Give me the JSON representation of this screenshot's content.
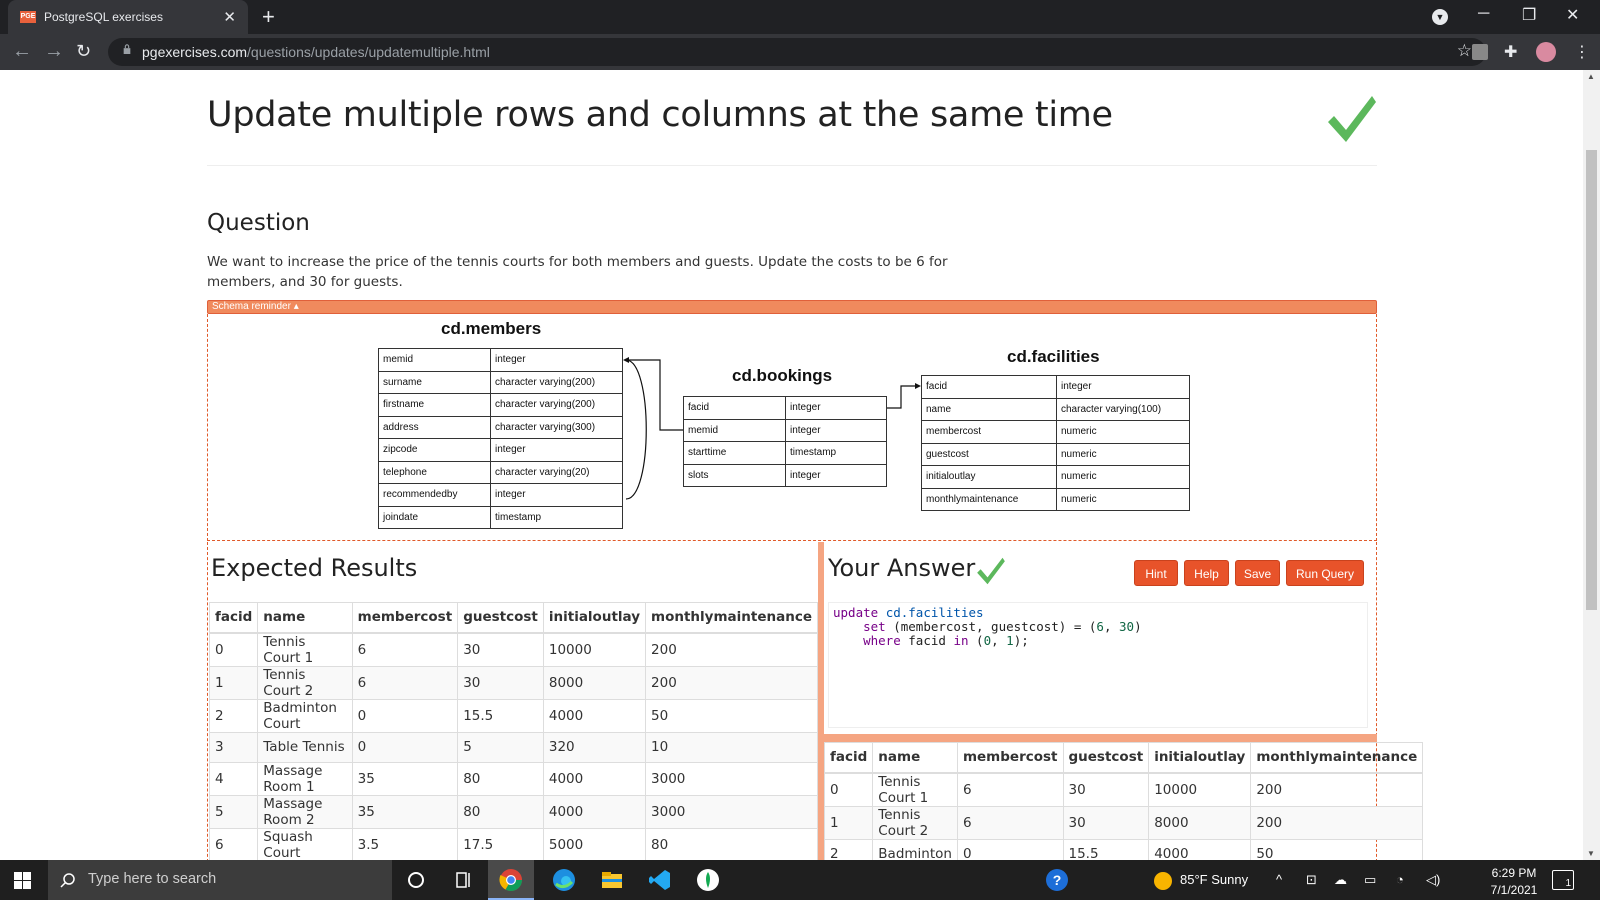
{
  "browser": {
    "tab_title": "PostgreSQL exercises",
    "tab_favicon": "PGE",
    "url_domain": "pgexercises.com",
    "url_path": "/questions/updates/updatemultiple.html"
  },
  "page": {
    "title": "Update multiple rows and columns at the same time",
    "question_heading": "Question",
    "question_text": "We want to increase the price of the tennis courts for both members and guests. Update the costs to be 6 for members, and 30 for guests.",
    "schema_toggle": "Schema reminder ▴"
  },
  "schema": {
    "members": {
      "title": "cd.members",
      "rows": [
        [
          "memid",
          "integer"
        ],
        [
          "surname",
          "character varying(200)"
        ],
        [
          "firstname",
          "character varying(200)"
        ],
        [
          "address",
          "character varying(300)"
        ],
        [
          "zipcode",
          "integer"
        ],
        [
          "telephone",
          "character varying(20)"
        ],
        [
          "recommendedby",
          "integer"
        ],
        [
          "joindate",
          "timestamp"
        ]
      ]
    },
    "bookings": {
      "title": "cd.bookings",
      "rows": [
        [
          "facid",
          "integer"
        ],
        [
          "memid",
          "integer"
        ],
        [
          "starttime",
          "timestamp"
        ],
        [
          "slots",
          "integer"
        ]
      ]
    },
    "facilities": {
      "title": "cd.facilities",
      "rows": [
        [
          "facid",
          "integer"
        ],
        [
          "name",
          "character varying(100)"
        ],
        [
          "membercost",
          "numeric"
        ],
        [
          "guestcost",
          "numeric"
        ],
        [
          "initialoutlay",
          "numeric"
        ],
        [
          "monthlymaintenance",
          "numeric"
        ]
      ]
    }
  },
  "expected": {
    "heading": "Expected Results",
    "columns": [
      "facid",
      "name",
      "membercost",
      "guestcost",
      "initialoutlay",
      "monthlymaintenance"
    ],
    "rows": [
      [
        "0",
        "Tennis Court 1",
        "6",
        "30",
        "10000",
        "200"
      ],
      [
        "1",
        "Tennis Court 2",
        "6",
        "30",
        "8000",
        "200"
      ],
      [
        "2",
        "Badminton Court",
        "0",
        "15.5",
        "4000",
        "50"
      ],
      [
        "3",
        "Table Tennis",
        "0",
        "5",
        "320",
        "10"
      ],
      [
        "4",
        "Massage Room 1",
        "35",
        "80",
        "4000",
        "3000"
      ],
      [
        "5",
        "Massage Room 2",
        "35",
        "80",
        "4000",
        "3000"
      ],
      [
        "6",
        "Squash Court",
        "3.5",
        "17.5",
        "5000",
        "80"
      ]
    ]
  },
  "answer": {
    "heading": "Your Answer",
    "buttons": {
      "hint": "Hint",
      "help": "Help",
      "save": "Save",
      "run": "Run Query"
    },
    "sql": {
      "l1_kw": "update",
      "l1_tbl": "cd.facilities",
      "l2_kw": "set",
      "l2_rest": " (membercost, guestcost) = (",
      "l2_n1": "6",
      "l2_comma": ", ",
      "l2_n2": "30",
      "l2_end": ")",
      "l3_kw1": "where",
      "l3_mid": " facid ",
      "l3_kw2": "in",
      "l3_open": " (",
      "l3_n1": "0",
      "l3_comma": ", ",
      "l3_n2": "1",
      "l3_end": ");"
    },
    "columns": [
      "facid",
      "name",
      "membercost",
      "guestcost",
      "initialoutlay",
      "monthlymaintenance"
    ],
    "rows": [
      [
        "0",
        "Tennis Court 1",
        "6",
        "30",
        "10000",
        "200"
      ],
      [
        "1",
        "Tennis Court 2",
        "6",
        "30",
        "8000",
        "200"
      ],
      [
        "2",
        "Badminton",
        "0",
        "15.5",
        "4000",
        "50"
      ]
    ]
  },
  "taskbar": {
    "search_placeholder": "Type here to search",
    "weather": "85°F  Sunny",
    "time": "6:29 PM",
    "date": "7/1/2021",
    "notifications": "1"
  },
  "colors": {
    "accent": "#e8532a",
    "check": "#5cb85c",
    "schema_bar": "#f08a5d"
  }
}
